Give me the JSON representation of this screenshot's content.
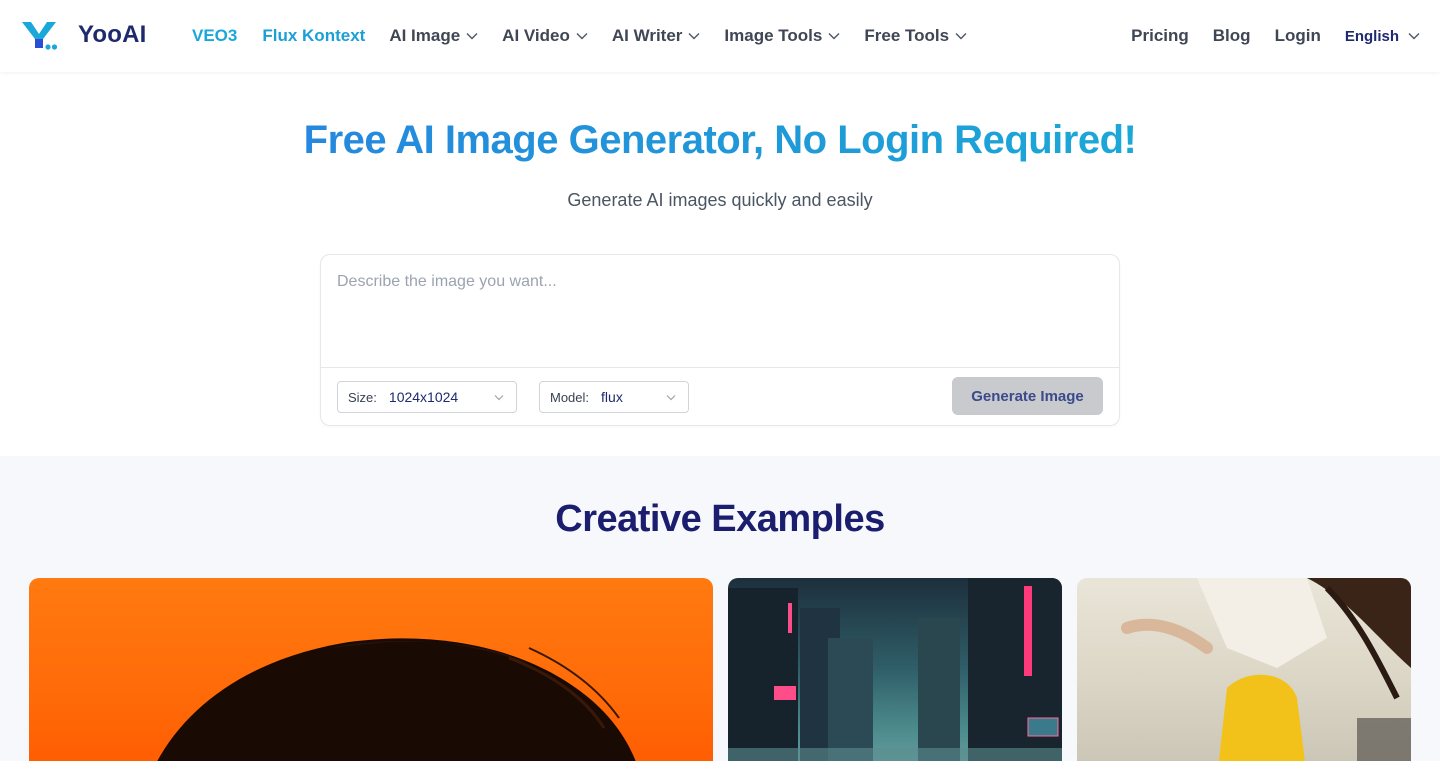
{
  "brand": {
    "name": "YooAI"
  },
  "nav": {
    "items": [
      {
        "label": "VEO3",
        "dropdown": false
      },
      {
        "label": "Flux Kontext",
        "dropdown": false
      },
      {
        "label": "AI Image",
        "dropdown": true
      },
      {
        "label": "AI Video",
        "dropdown": true
      },
      {
        "label": "AI Writer",
        "dropdown": true
      },
      {
        "label": "Image Tools",
        "dropdown": true
      },
      {
        "label": "Free Tools",
        "dropdown": true
      }
    ],
    "right": [
      {
        "label": "Pricing"
      },
      {
        "label": "Blog"
      },
      {
        "label": "Login"
      }
    ],
    "language": "English"
  },
  "hero": {
    "title": "Free AI Image Generator, No Login Required!",
    "subtitle": "Generate AI images quickly and easily"
  },
  "generator": {
    "prompt_placeholder": "Describe the image you want...",
    "prompt_value": "",
    "size_label": "Size:",
    "size_value": "1024x1024",
    "model_label": "Model:",
    "model_value": "flux",
    "generate_label": "Generate Image"
  },
  "examples": {
    "title": "Creative Examples"
  },
  "colors": {
    "accent": "#1aa7d9",
    "brand_dark": "#1e2a6e",
    "button_disabled": "#c9cacd"
  }
}
